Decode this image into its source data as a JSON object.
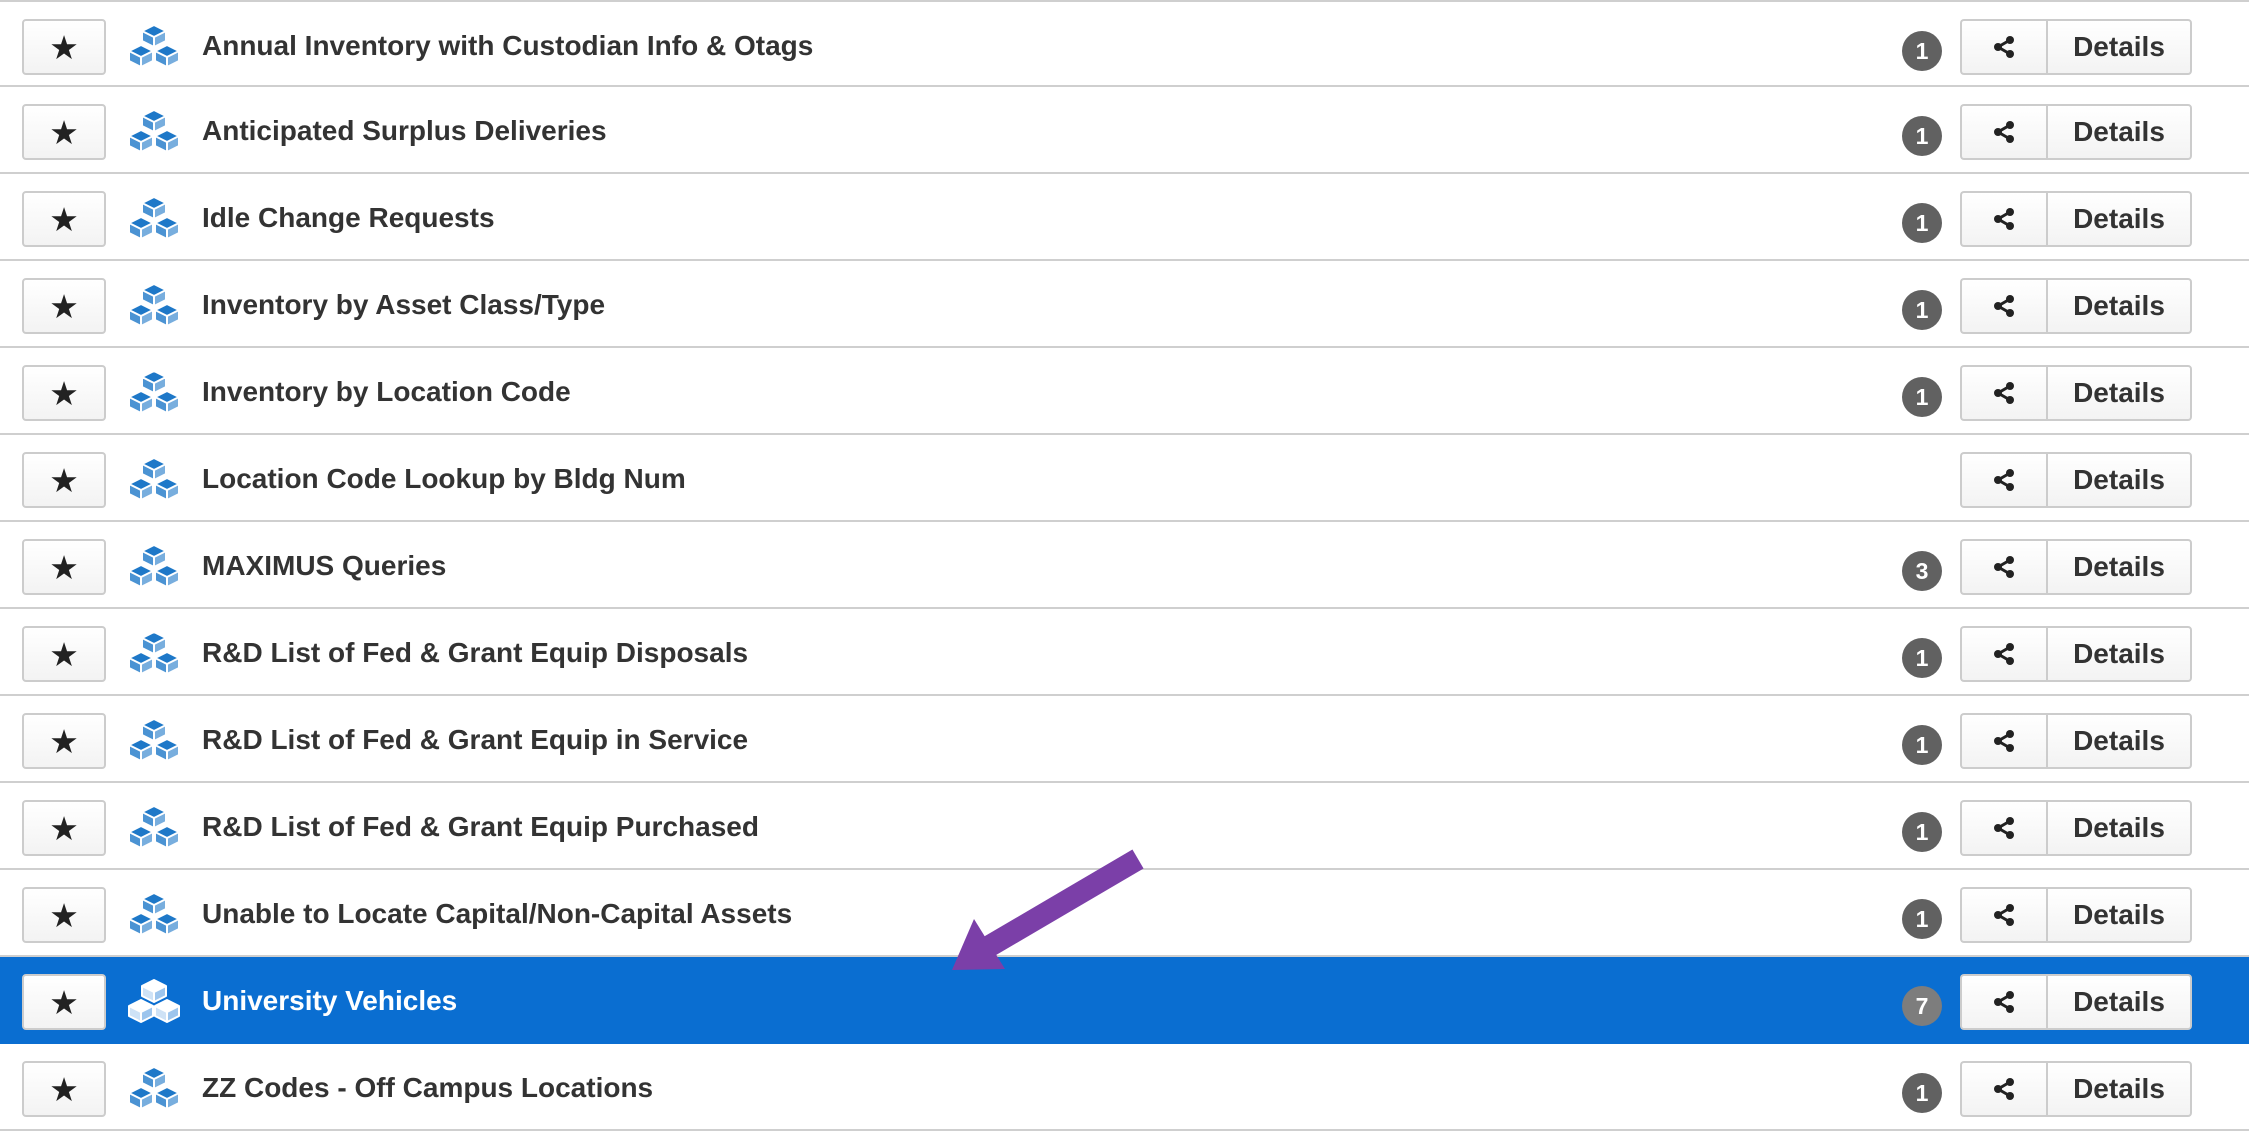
{
  "buttons": {
    "details_label": "Details"
  },
  "icons": {
    "star": "star-icon",
    "cube": "cubes-icon",
    "share": "share-icon"
  },
  "colors": {
    "selected_row": "#0a6ed1",
    "icon_blue": "#1e78c8",
    "badge": "#616161",
    "annotation_arrow": "#7b3fa8"
  },
  "rows": [
    {
      "title": "Annual Inventory with Custodian Info & Otags",
      "count": "1",
      "selected": false
    },
    {
      "title": "Anticipated Surplus Deliveries",
      "count": "1",
      "selected": false
    },
    {
      "title": "Idle Change Requests",
      "count": "1",
      "selected": false
    },
    {
      "title": "Inventory by Asset Class/Type",
      "count": "1",
      "selected": false
    },
    {
      "title": "Inventory by Location Code",
      "count": "1",
      "selected": false
    },
    {
      "title": "Location Code Lookup by Bldg Num",
      "count": "",
      "selected": false
    },
    {
      "title": "MAXIMUS Queries",
      "count": "3",
      "selected": false
    },
    {
      "title": "R&D List of Fed & Grant Equip Disposals",
      "count": "1",
      "selected": false
    },
    {
      "title": "R&D List of Fed & Grant Equip in Service",
      "count": "1",
      "selected": false
    },
    {
      "title": "R&D List of Fed & Grant Equip Purchased",
      "count": "1",
      "selected": false
    },
    {
      "title": "Unable to Locate Capital/Non-Capital Assets",
      "count": "1",
      "selected": false
    },
    {
      "title": "University Vehicles",
      "count": "7",
      "selected": true
    },
    {
      "title": "ZZ Codes - Off Campus Locations",
      "count": "1",
      "selected": false
    }
  ]
}
